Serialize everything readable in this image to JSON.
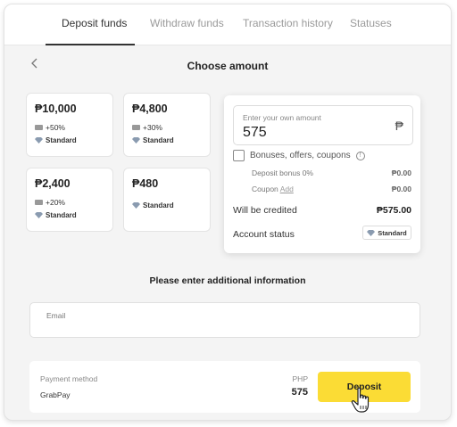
{
  "tabs": [
    {
      "label": "Deposit funds",
      "active": true
    },
    {
      "label": "Withdraw funds",
      "active": false
    },
    {
      "label": "Transaction history",
      "active": false
    },
    {
      "label": "Statuses",
      "active": false
    }
  ],
  "header": {
    "title": "Choose amount",
    "back_icon": "chevron-left-icon"
  },
  "amounts": [
    {
      "amount": "₱10,000",
      "bonus": "+50%",
      "level": "Standard"
    },
    {
      "amount": "₱4,800",
      "bonus": "+30%",
      "level": "Standard"
    },
    {
      "amount": "₱2,400",
      "bonus": "+20%",
      "level": "Standard"
    },
    {
      "amount": "₱480",
      "bonus": "",
      "level": "Standard"
    }
  ],
  "custom_amount": {
    "placeholder": "Enter your own amount",
    "value": "575",
    "currency_symbol": "₱"
  },
  "bonuses": {
    "label": "Bonuses, offers, coupons",
    "checked": false,
    "deposit_bonus_label": "Deposit bonus 0%",
    "deposit_bonus_value": "₱0.00",
    "coupon_label": "Coupon",
    "coupon_link": "Add",
    "coupon_value": "₱0.00"
  },
  "summary": {
    "credited_label": "Will be credited",
    "credited_value": "₱575.00",
    "status_label": "Account status",
    "status_value": "Standard"
  },
  "additional": {
    "title": "Please enter additional information",
    "email_placeholder": "Email"
  },
  "payment": {
    "method_label": "Payment method",
    "method_value": "GrabPay",
    "currency": "PHP",
    "amount": "575",
    "deposit_label": "Deposit"
  },
  "colors": {
    "accent": "#fbdc35",
    "background": "#f4f4f4"
  }
}
